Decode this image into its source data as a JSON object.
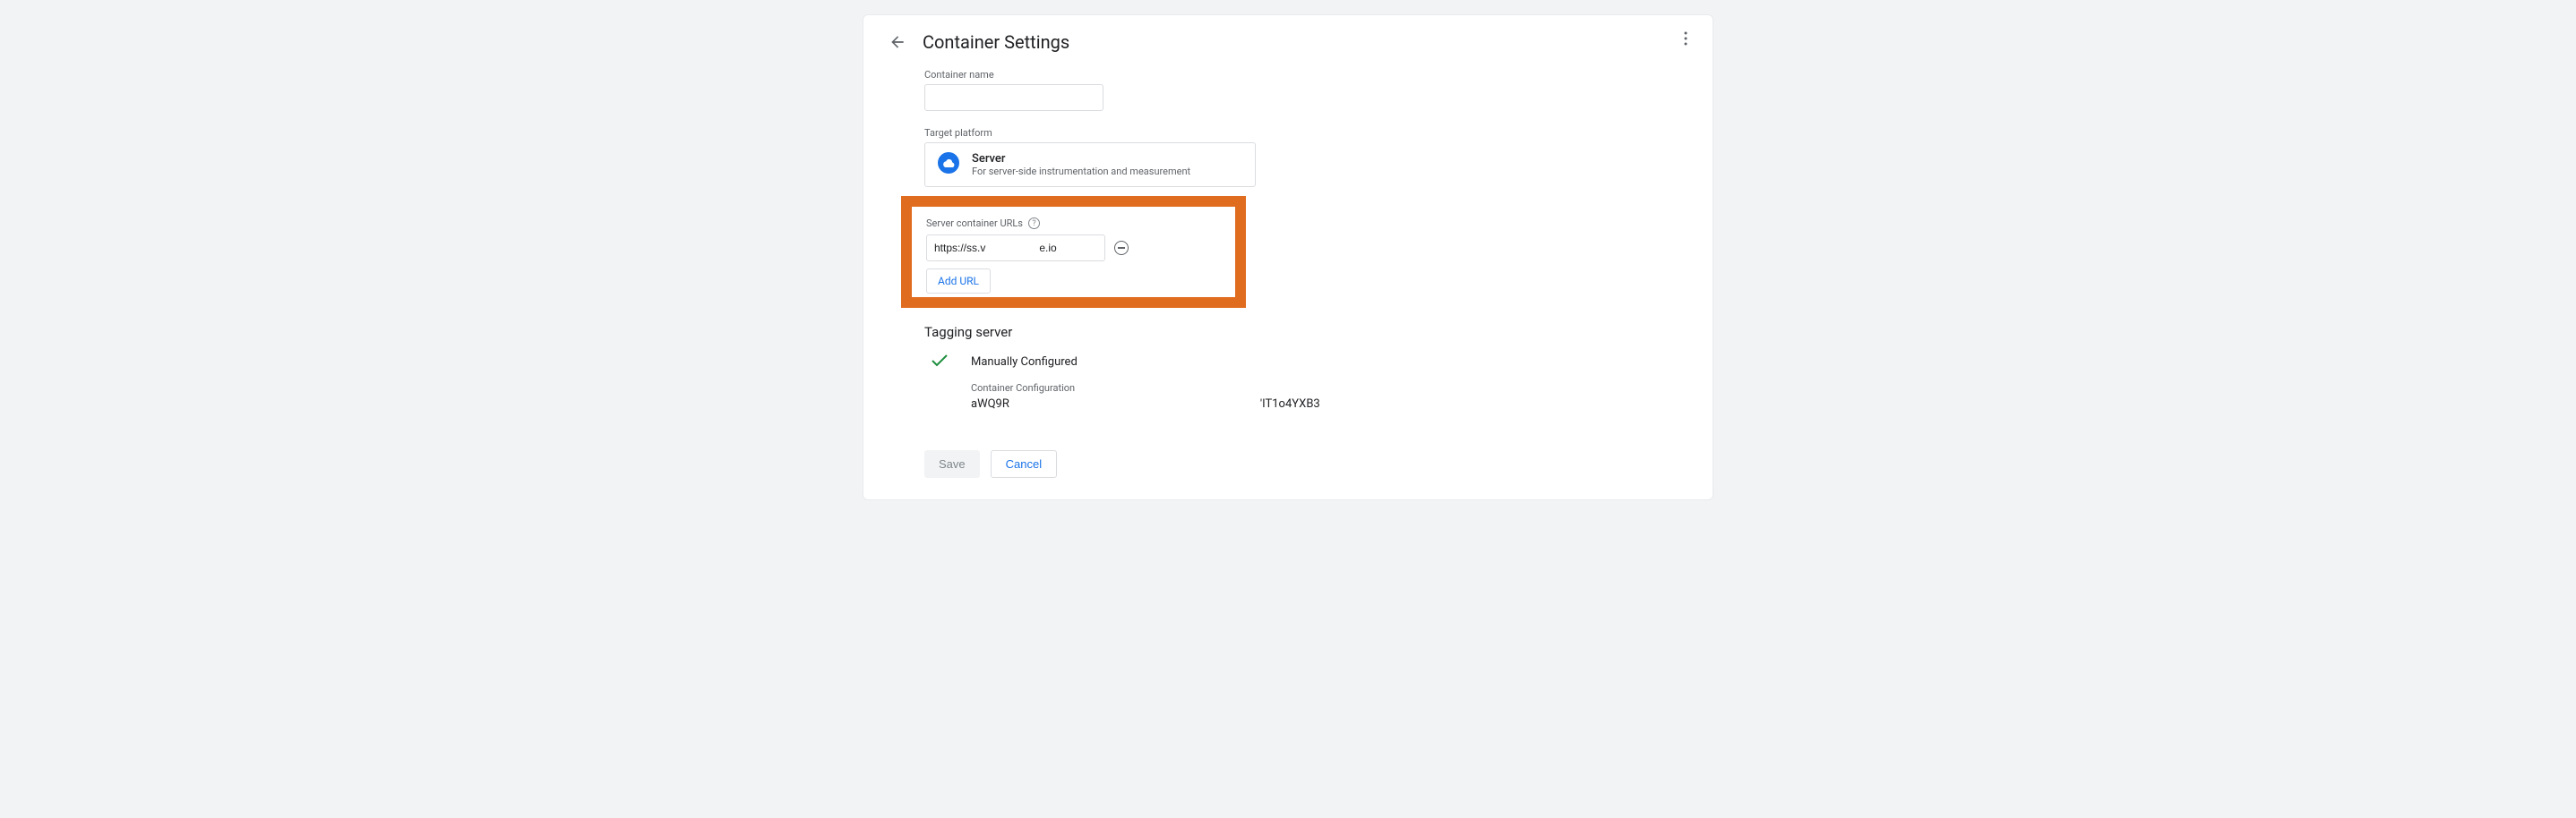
{
  "header": {
    "title": "Container Settings"
  },
  "containerName": {
    "label": "Container name",
    "value": ""
  },
  "targetPlatform": {
    "label": "Target platform",
    "name": "Server",
    "description": "For server-side instrumentation and measurement"
  },
  "serverUrls": {
    "label": "Server container URLs",
    "url_value": "https://ss.v                  e.io",
    "add_label": "Add URL"
  },
  "taggingServer": {
    "title": "Tagging server",
    "status": "Manually Configured",
    "config_label": "Container Configuration",
    "token1": "aWQ9R",
    "token2": "'IT1o4YXB3"
  },
  "actions": {
    "save": "Save",
    "cancel": "Cancel"
  }
}
